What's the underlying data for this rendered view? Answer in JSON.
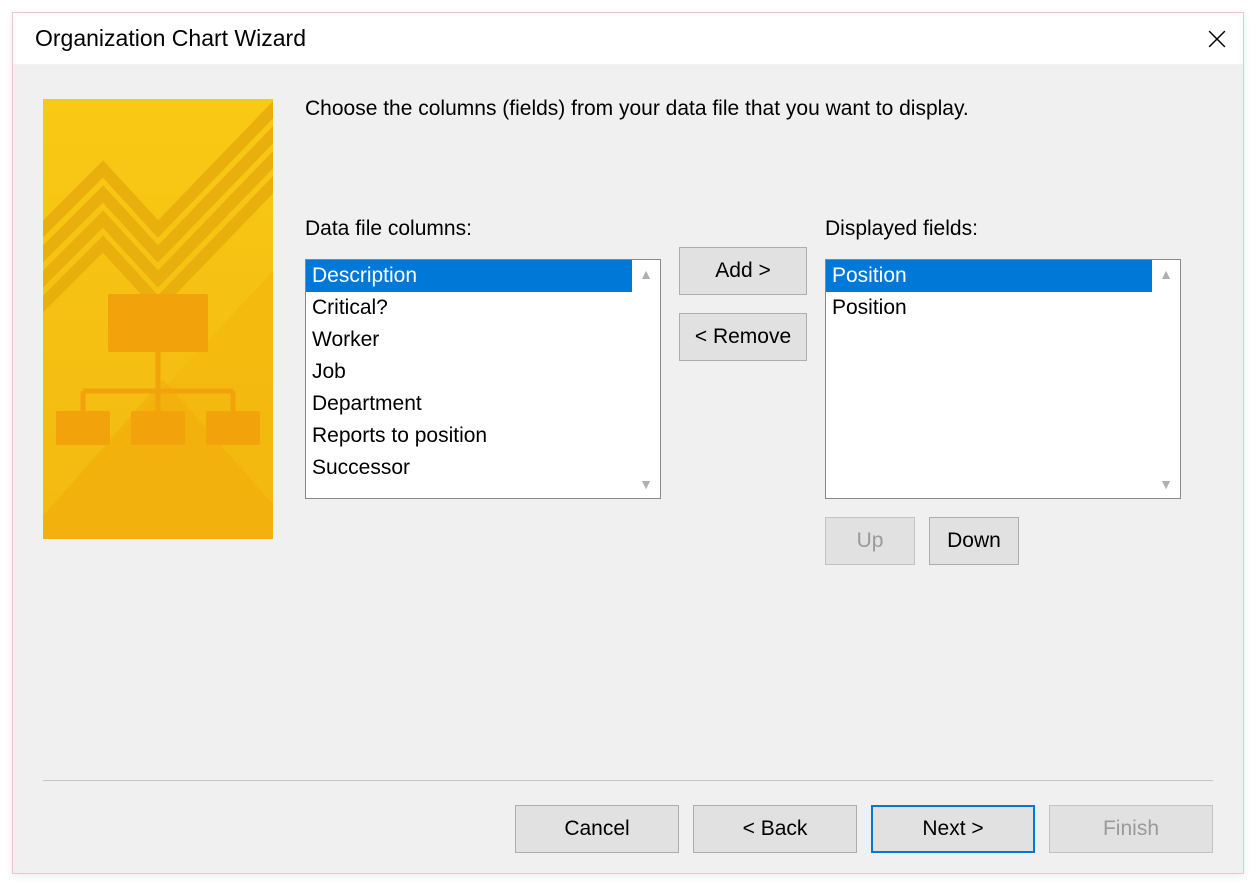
{
  "window": {
    "title": "Organization Chart Wizard"
  },
  "instruction": "Choose the columns (fields) from your data file that you want to display.",
  "labels": {
    "data_file_columns": "Data file columns:",
    "displayed_fields": "Displayed fields:"
  },
  "data_file_columns": [
    "Description",
    "Critical?",
    "Worker",
    "Job",
    "Department",
    "Reports to position",
    "Successor"
  ],
  "data_file_selected_index": 0,
  "displayed_fields": [
    "Position",
    "Position"
  ],
  "displayed_selected_index": 0,
  "buttons": {
    "add": "Add >",
    "remove": "< Remove",
    "up": "Up",
    "down": "Down",
    "cancel": "Cancel",
    "back": "< Back",
    "next": "Next >",
    "finish": "Finish"
  }
}
